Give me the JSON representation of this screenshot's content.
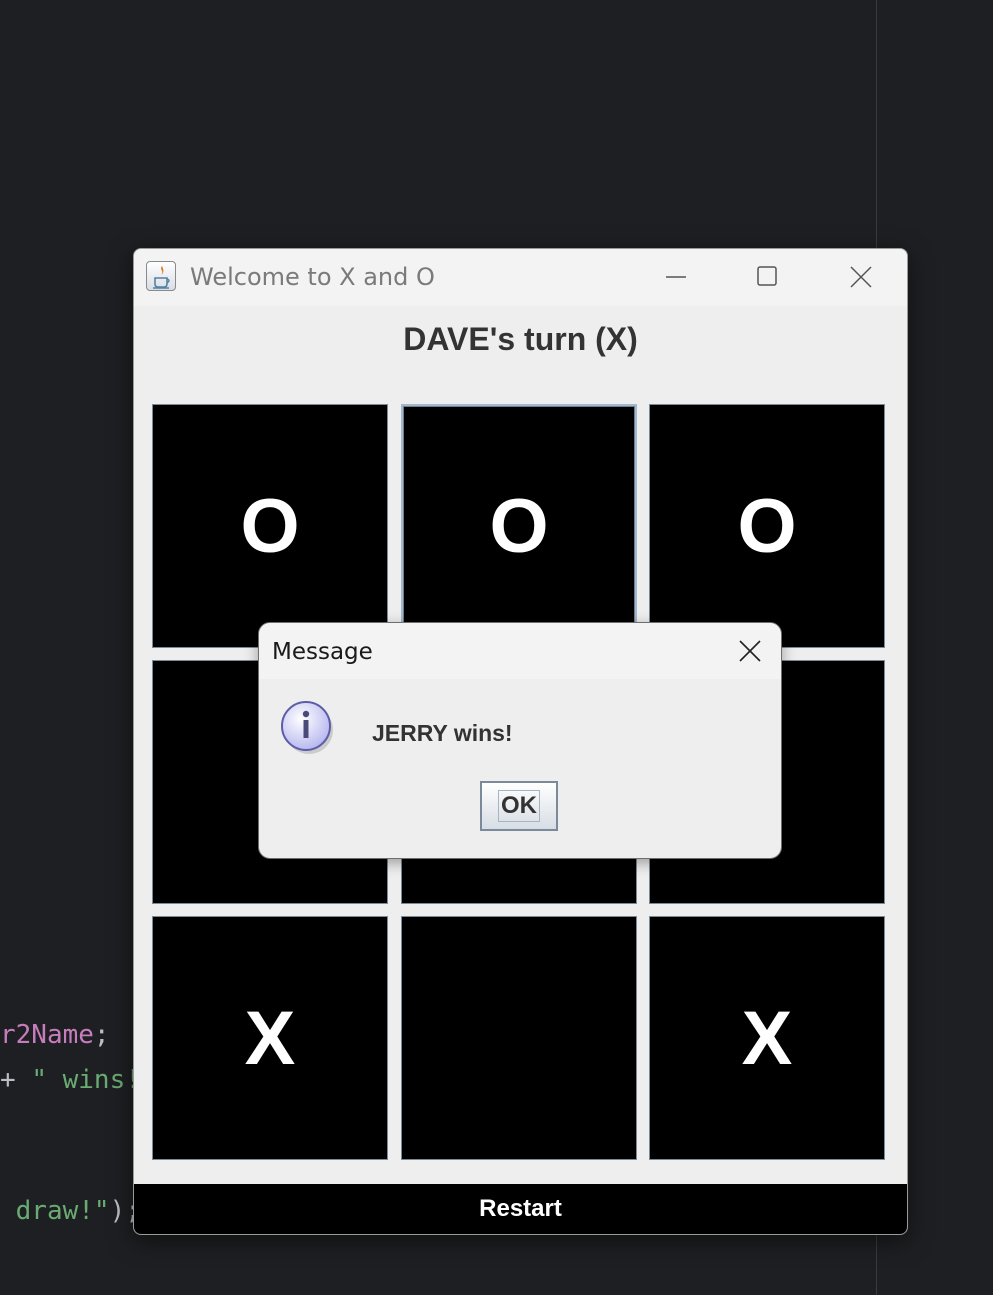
{
  "editor": {
    "code_lines": [
      {
        "parts": [
          "r2Name",
          ";"
        ]
      },
      {
        "parts": [
          "+ ",
          "\" wins!"
        ]
      },
      {
        "parts": [
          " draw!\"",
          ");"
        ]
      }
    ]
  },
  "window": {
    "title": "Welcome to X and O",
    "controls": [
      "minimize",
      "maximize",
      "close"
    ]
  },
  "game": {
    "turn_label": "DAVE's turn (X)",
    "board": [
      "O",
      "O",
      "O",
      "",
      "",
      "",
      "X",
      "",
      "X"
    ],
    "restart_label": "Restart"
  },
  "dialog": {
    "title": "Message",
    "message": "JERRY wins!",
    "ok_label": "OK",
    "icon": "info-icon"
  }
}
